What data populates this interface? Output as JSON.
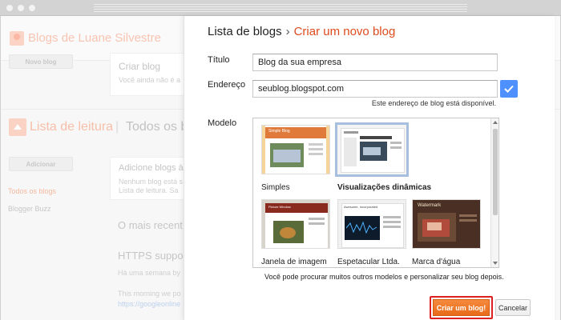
{
  "background": {
    "blog_name": "Blogs de Luane Silvestre",
    "new_blog_button": "Novo blog",
    "create_blog_title": "Criar blog",
    "create_blog_text": "Você ainda não é a",
    "reading_list_title": "Lista de leitura",
    "reading_list_tab": "Todos os b",
    "add_button": "Adicionar",
    "sidebar_all_blogs": "Todos os blogs",
    "sidebar_blogger_buzz": "Blogger Buzz",
    "add_blogs_title": "Adicione blogs à",
    "add_blogs_line2": "Nenhum blog está s",
    "add_blogs_line3": "Lista de leitura. Sa",
    "most_recent": "O mais recent",
    "post_title": "HTTPS suppor",
    "post_meta": "Há uma semana by",
    "post_line1": "This morning we po",
    "post_link": "https://googleonline"
  },
  "modal": {
    "breadcrumb_root": "Lista de blogs",
    "breadcrumb_sep": "›",
    "breadcrumb_current": "Criar um novo blog",
    "title_label": "Título",
    "title_value": "Blog da sua empresa",
    "address_label": "Endereço",
    "address_value": "seublog.blogspot.com",
    "address_hint": "Este endereço de blog está disponível.",
    "template_label": "Modelo",
    "templates": [
      {
        "name": "Simples",
        "selected": false
      },
      {
        "name": "Visualizações dinâmicas",
        "selected": true
      },
      {
        "name": "Janela de imagem",
        "selected": false
      },
      {
        "name": "Espetacular Ltda.",
        "selected": false
      },
      {
        "name": "Marca d'água",
        "selected": false
      }
    ],
    "template_thumb_texts": {
      "simple_header": "Simple Blog",
      "picture_header": "Picture Window",
      "watermark_header": "Watermark",
      "awesome_header": "Awesome, Incorporated"
    },
    "footer_note": "Você pode procurar muitos outros modelos e personalizar seu blog depois.",
    "create_button": "Criar um blog!",
    "cancel_button": "Cancelar"
  },
  "colors": {
    "accent_orange": "#dd4b1f",
    "button_orange": "#f07c2c",
    "highlight_red": "#dd2020",
    "check_blue": "#4d90fe",
    "selection_blue": "#a7bedf"
  }
}
